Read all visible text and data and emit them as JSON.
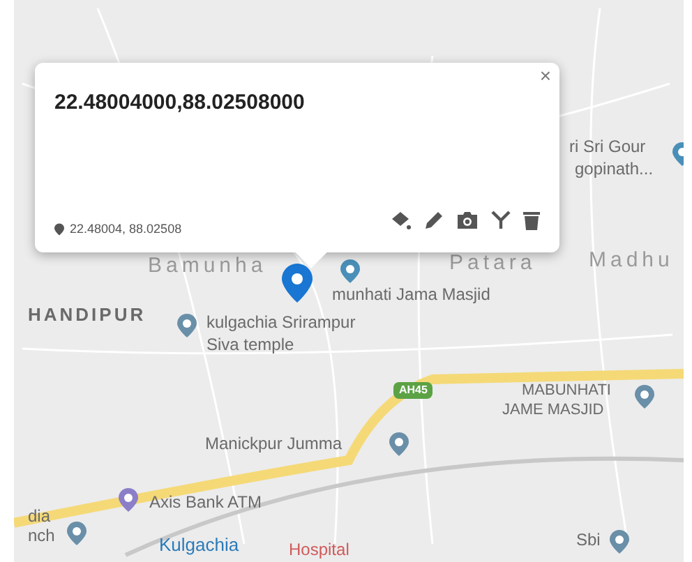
{
  "popup": {
    "title": "22.48004000,88.02508000",
    "coordinates": "22.48004, 88.02508",
    "close": "×"
  },
  "map_labels": [
    {
      "text": "ri Sri Gour",
      "kind": "poi"
    },
    {
      "text": "gopinath...",
      "kind": "poi-line"
    },
    {
      "text": "Bamunha",
      "kind": "area"
    },
    {
      "text": "Patara",
      "kind": "area"
    },
    {
      "text": "Madhu",
      "kind": "area"
    },
    {
      "text": "munhati Jama Masjid",
      "kind": "poi"
    },
    {
      "text": "HANDIPUR",
      "kind": "town"
    },
    {
      "text": "kulgachia Srirampur",
      "kind": "poi"
    },
    {
      "text": "Siva temple",
      "kind": "poi-line"
    },
    {
      "text": "AH45",
      "kind": "road"
    },
    {
      "text": "MABUNHATI",
      "kind": "poi-caps"
    },
    {
      "text": "JAME MASJID",
      "kind": "poi-caps"
    },
    {
      "text": "Manickpur Jumma",
      "kind": "poi"
    },
    {
      "text": "Axis Bank ATM",
      "kind": "poi"
    },
    {
      "text": "dia",
      "kind": "poi"
    },
    {
      "text": "nch",
      "kind": "poi"
    },
    {
      "text": "Kulgachia",
      "kind": "transit"
    },
    {
      "text": "Hospital",
      "kind": "hospital"
    },
    {
      "text": "Sbi",
      "kind": "poi"
    }
  ]
}
